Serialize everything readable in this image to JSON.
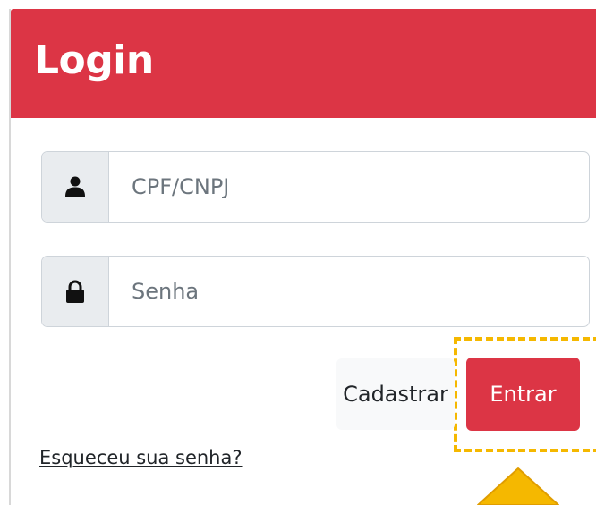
{
  "header": {
    "title": "Login"
  },
  "form": {
    "user_field": {
      "placeholder": "CPF/CNPJ",
      "icon": "user-icon"
    },
    "password_field": {
      "placeholder": "Senha",
      "icon": "lock-icon"
    },
    "register_label": "Cadastrar",
    "submit_label": "Entrar",
    "forgot_password_label": "Esqueceu sua senha?"
  },
  "annotations": {
    "highlight_color": "#f5b800",
    "arrow_color": "#f5b800"
  },
  "colors": {
    "brand": "#dc3545",
    "input_addon": "#e9ecef",
    "border": "#ced4da"
  }
}
